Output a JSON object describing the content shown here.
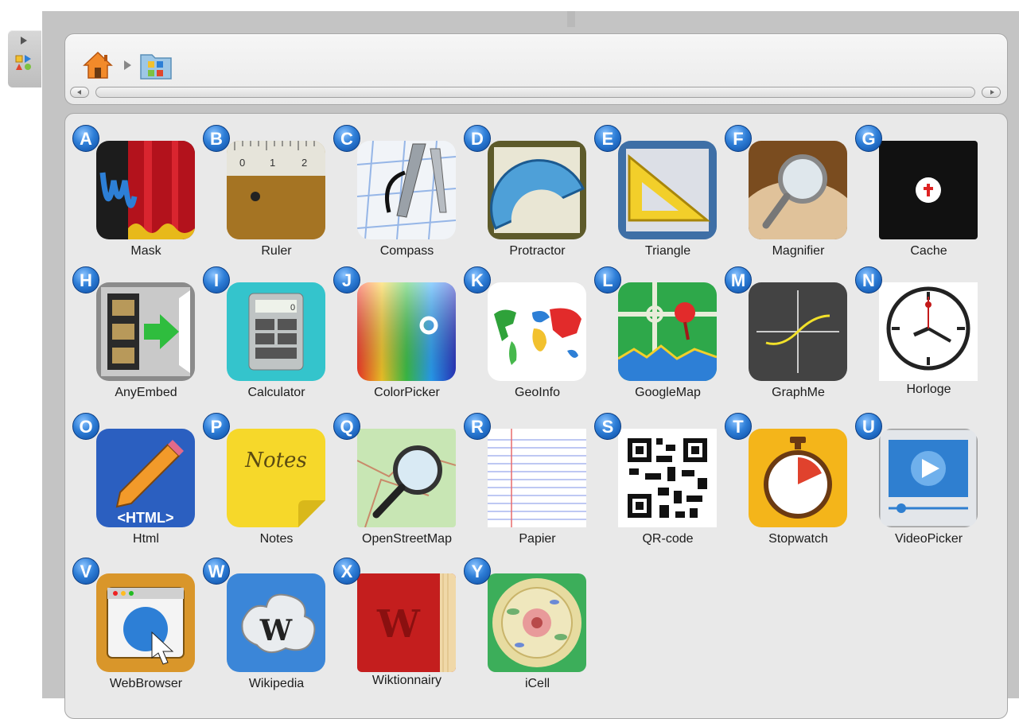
{
  "nav": {
    "home_icon": "home-icon",
    "breadcrumb_folder_icon": "applications-folder-icon"
  },
  "dock": {
    "toggle_icon": "expand-arrow-icon",
    "app_icon": "applications-icon"
  },
  "apps": [
    {
      "letter": "A",
      "label": "Mask",
      "icon": "mask-icon"
    },
    {
      "letter": "B",
      "label": "Ruler",
      "icon": "ruler-icon",
      "ruler_ticks": [
        "0",
        "1",
        "2"
      ]
    },
    {
      "letter": "C",
      "label": "Compass",
      "icon": "compass-icon"
    },
    {
      "letter": "D",
      "label": "Protractor",
      "icon": "protractor-icon"
    },
    {
      "letter": "E",
      "label": "Triangle",
      "icon": "triangle-icon"
    },
    {
      "letter": "F",
      "label": "Magnifier",
      "icon": "magnifier-icon"
    },
    {
      "letter": "G",
      "label": "Cache",
      "icon": "cache-icon"
    },
    {
      "letter": "H",
      "label": "AnyEmbed",
      "icon": "film-embed-icon"
    },
    {
      "letter": "I",
      "label": "Calculator",
      "icon": "calculator-icon",
      "calc_display": "0"
    },
    {
      "letter": "J",
      "label": "ColorPicker",
      "icon": "color-picker-icon"
    },
    {
      "letter": "K",
      "label": "GeoInfo",
      "icon": "world-map-icon"
    },
    {
      "letter": "L",
      "label": "GoogleMap",
      "icon": "map-pin-icon"
    },
    {
      "letter": "M",
      "label": "GraphMe",
      "icon": "graph-icon"
    },
    {
      "letter": "N",
      "label": "Horloge",
      "icon": "clock-icon"
    },
    {
      "letter": "O",
      "label": "Html",
      "icon": "html-pencil-icon",
      "icon_text": "<HTML>"
    },
    {
      "letter": "P",
      "label": "Notes",
      "icon": "notes-icon",
      "icon_text": "Notes"
    },
    {
      "letter": "Q",
      "label": "OpenStreetMap",
      "icon": "map-magnifier-icon"
    },
    {
      "letter": "R",
      "label": "Papier",
      "icon": "lined-paper-icon"
    },
    {
      "letter": "S",
      "label": "QR-code",
      "icon": "qr-code-icon"
    },
    {
      "letter": "T",
      "label": "Stopwatch",
      "icon": "stopwatch-icon"
    },
    {
      "letter": "U",
      "label": "VideoPicker",
      "icon": "video-player-icon"
    },
    {
      "letter": "V",
      "label": "WebBrowser",
      "icon": "web-browser-icon"
    },
    {
      "letter": "W",
      "label": "Wikipedia",
      "icon": "wikipedia-icon",
      "icon_text": "W"
    },
    {
      "letter": "X",
      "label": "Wiktionnairy",
      "icon": "wiktionary-book-icon",
      "icon_text": "W"
    },
    {
      "letter": "Y",
      "label": "iCell",
      "icon": "cell-icon"
    }
  ]
}
